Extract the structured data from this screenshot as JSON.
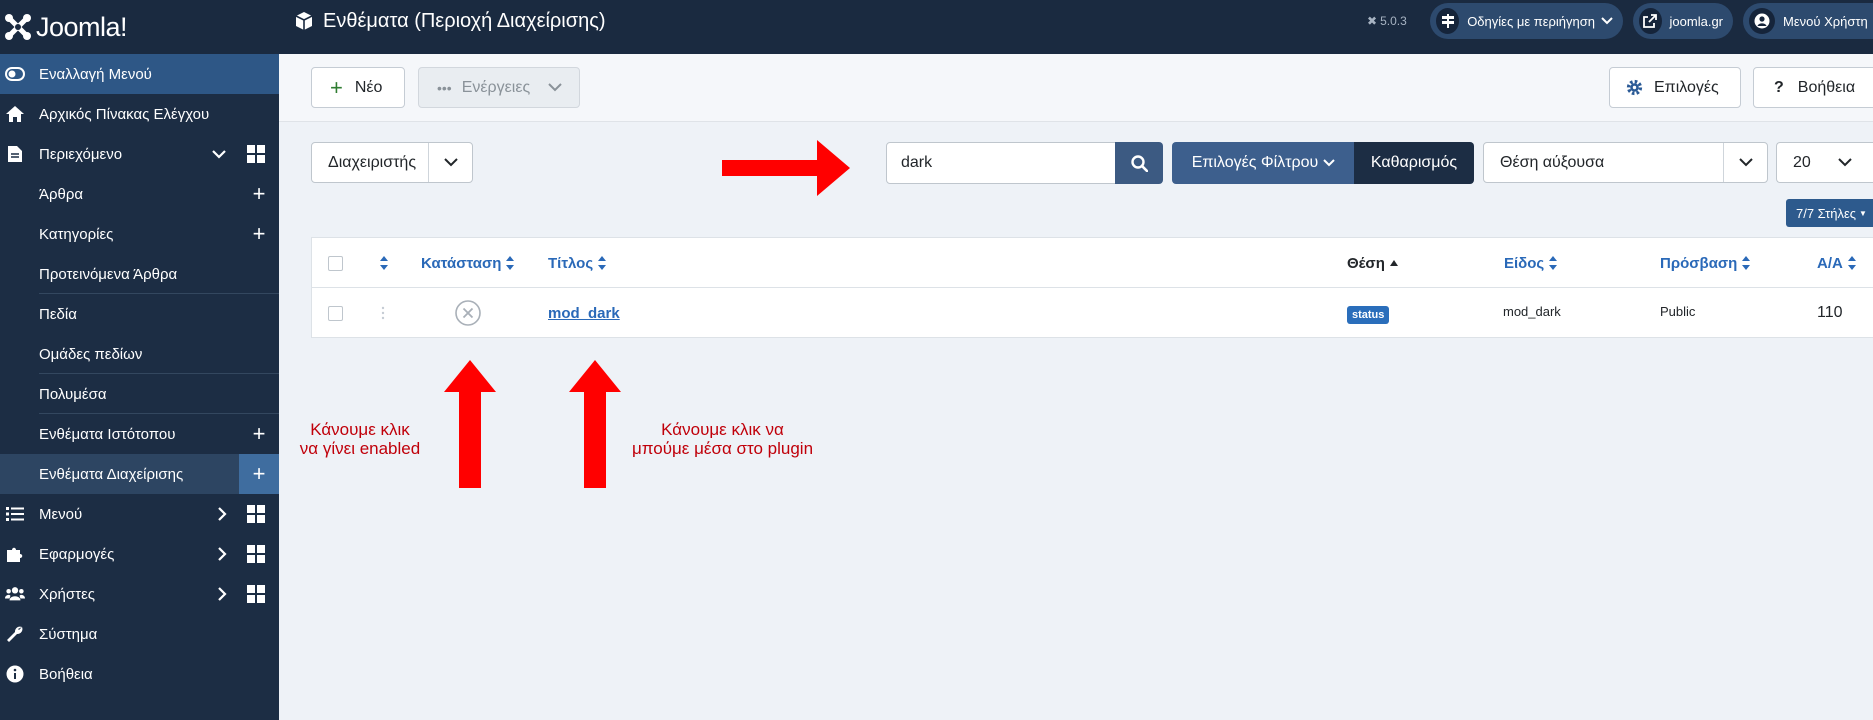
{
  "header": {
    "brand": "Joomla!",
    "page_title": "Ενθέματα (Περιοχή Διαχείρισης)",
    "version": "5.0.3",
    "guided_tours": "Οδηγίες με περιήγηση",
    "site_link": "joomla.gr",
    "user_menu": "Μενού Χρήστη"
  },
  "sidebar": {
    "toggle": "Εναλλαγή Μενού",
    "dashboard": "Αρχικός Πίνακας Ελέγχου",
    "content": "Περιεχόμενο",
    "articles": "Άρθρα",
    "categories": "Κατηγορίες",
    "featured": "Προτεινόμενα Άρθρα",
    "fields": "Πεδία",
    "field_groups": "Ομάδες πεδίων",
    "media": "Πολυμέσα",
    "site_modules": "Ενθέματα Ιστότοπου",
    "admin_modules": "Ενθέματα Διαχείρισης",
    "menus": "Μενού",
    "components": "Εφαρμογές",
    "users": "Χρήστες",
    "system": "Σύστημα",
    "help": "Βοήθεια"
  },
  "toolbar": {
    "new_label": "Νέο",
    "actions_label": "Ενέργειες",
    "options_label": "Επιλογές",
    "help_label": "Βοήθεια"
  },
  "filters": {
    "client": "Διαχειριστής",
    "search_value": "dark",
    "filter_options": "Επιλογές Φίλτρου",
    "clear": "Καθαρισμός",
    "ordering": "Θέση αύξουσα",
    "limit": "20",
    "columns": "7/7 Στήλες"
  },
  "table": {
    "headers": {
      "status": "Κατάσταση",
      "title": "Τίτλος",
      "position": "Θέση",
      "type": "Είδος",
      "access": "Πρόσβαση",
      "id": "Α/Α"
    },
    "rows": [
      {
        "title": "mod_dark",
        "position": "status",
        "type": "mod_dark",
        "access": "Public",
        "id": "110"
      }
    ]
  },
  "annotations": {
    "note1_line1": "Κάνουμε κλικ",
    "note1_line2": "να γίνει enabled",
    "note2_line1": "Κάνουμε κλικ να",
    "note2_line2": "μπούμε μέσα στο plugin"
  },
  "colors": {
    "header_bg": "#1a2a40",
    "sidebar_bg": "#1c2d44",
    "accent": "#2a69b8",
    "annotation": "#ff0000"
  }
}
